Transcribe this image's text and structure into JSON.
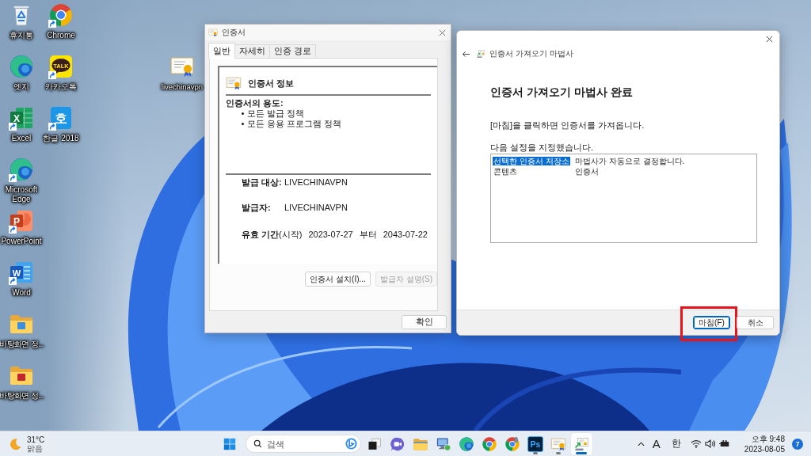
{
  "desktop": {
    "icons": [
      {
        "label": "휴지통",
        "kind": "recycle-bin",
        "shortcut": false
      },
      {
        "label": "엣지",
        "kind": "edge",
        "shortcut": false
      },
      {
        "label": "Excel",
        "kind": "excel",
        "glyph": "X",
        "shortcut": true
      },
      {
        "label": "Microsoft Edge",
        "kind": "edge",
        "shortcut": true
      },
      {
        "label": "PowerPoint",
        "kind": "powerpoint",
        "glyph": "P",
        "shortcut": true
      },
      {
        "label": "Word",
        "kind": "word",
        "glyph": "W",
        "shortcut": true
      },
      {
        "label": "바탕화면 정...",
        "kind": "folder",
        "color": "#3d8fe0",
        "shortcut": false
      },
      {
        "label": "바탕화면 정...",
        "kind": "folder",
        "color": "#c4262e",
        "shortcut": false
      },
      {
        "label": "Chrome",
        "kind": "chrome",
        "shortcut": true
      },
      {
        "label": "카카오톡",
        "kind": "kakaotalk",
        "glyph": "TALK",
        "shortcut": true
      },
      {
        "label": "한글 2018",
        "kind": "hangul",
        "glyph": "호",
        "shortcut": true
      }
    ],
    "file": {
      "label": "livechinavpn"
    }
  },
  "certificate_dialog": {
    "title": "인증서",
    "tabs": [
      {
        "label": "일반",
        "selected": true
      },
      {
        "label": "자세히",
        "selected": false
      },
      {
        "label": "인증 경로",
        "selected": false
      }
    ],
    "info_title": "인증서 정보",
    "purpose_heading": "인증서의 용도:",
    "purposes": [
      "모든 발급 정책",
      "모든 응용 프로그램 정책"
    ],
    "fields": [
      {
        "label": "발급 대상:",
        "value": "LIVECHINAVPN"
      },
      {
        "label": "발급자:",
        "value": "LIVECHINAVPN"
      }
    ],
    "validity": {
      "label": "**유효 기간**(시작)",
      "start": "2023-07-27",
      "until_word": "부터",
      "end": "2043-07-22"
    },
    "buttons": [
      {
        "label": "인증서 설치(I)...",
        "disabled": false
      },
      {
        "label": "발급자 설명(S)",
        "disabled": true
      }
    ],
    "ok_button": "확인"
  },
  "import_wizard": {
    "title": "인증서 가져오기 마법사",
    "heading": "인증서 가져오기 마법사 완료",
    "instruction": "[마침]을 클릭하면 인증서를 가져옵니다.",
    "settings_label": "다음 설정을 지정했습니다.",
    "settings": [
      {
        "name": "선택한 인증서 저장소",
        "value": "마법사가 자동으로 결정합니다.",
        "selected": true
      },
      {
        "name": "콘텐츠",
        "value": "인증서",
        "selected": false
      }
    ],
    "buttons": [
      {
        "label": "마침(F)",
        "default": true,
        "highlighted": true
      },
      {
        "label": "취소",
        "default": false,
        "highlighted": false
      }
    ]
  },
  "taskbar": {
    "weather": {
      "temperature": "31°C",
      "condition": "맑음"
    },
    "search": {
      "placeholder": "검색"
    },
    "apps": [
      {
        "kind": "task-view",
        "running": false,
        "selected": false
      },
      {
        "kind": "video-chat",
        "running": false,
        "selected": false
      },
      {
        "kind": "file-explorer",
        "running": false,
        "selected": false
      },
      {
        "kind": "network-monitor",
        "running": false,
        "selected": false
      },
      {
        "kind": "edge",
        "running": false,
        "selected": false
      },
      {
        "kind": "chrome",
        "running": false,
        "selected": false
      },
      {
        "kind": "chrome-dev",
        "running": false,
        "selected": false
      },
      {
        "kind": "photoshop",
        "glyph": "Ps",
        "running": true,
        "selected": false
      },
      {
        "kind": "certificate",
        "running": true,
        "selected": false
      },
      {
        "kind": "certificate-wizard",
        "running": true,
        "selected": true
      }
    ],
    "tray": {
      "input_mode": "A",
      "ime": "한",
      "time": "오후 9:48",
      "date": "2023-08-05",
      "notification_count": "7"
    }
  }
}
